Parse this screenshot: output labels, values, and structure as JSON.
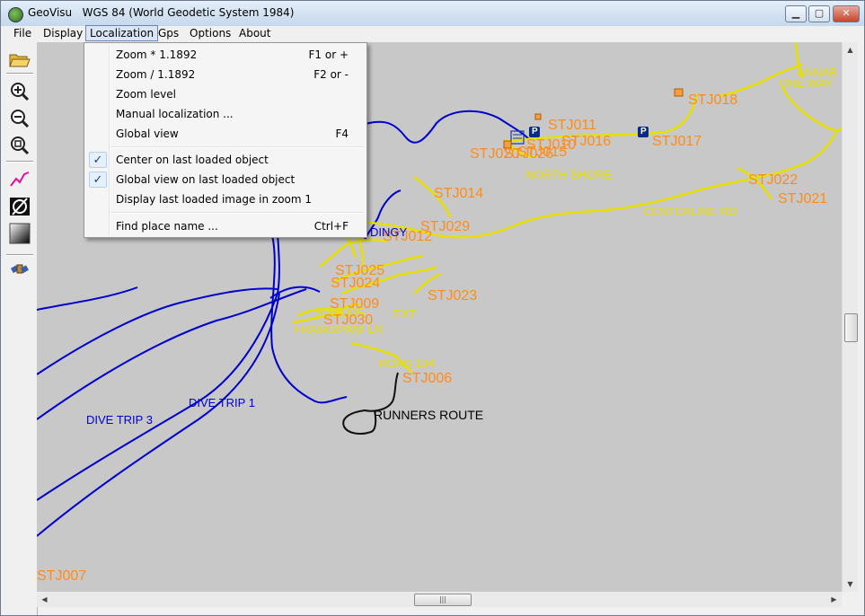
{
  "window": {
    "app_name": "GeoVisu",
    "projection": "WGS 84 (World Geodetic System 1984)",
    "min_label": "▁",
    "max_label": "▢",
    "close_label": "✕"
  },
  "menu": {
    "items": [
      "File",
      "Display",
      "Localization",
      "Gps",
      "Options",
      "About"
    ],
    "active": "Localization"
  },
  "dropdown": {
    "items": [
      {
        "label": "Zoom * 1.1892",
        "shortcut": "F1 or +",
        "checked": false
      },
      {
        "label": "Zoom / 1.1892",
        "shortcut": "F2 or -",
        "checked": false
      },
      {
        "label": "Zoom level",
        "shortcut": "",
        "checked": false
      },
      {
        "label": "Manual localization ...",
        "shortcut": "",
        "checked": false
      },
      {
        "label": "Global view",
        "shortcut": "F4",
        "checked": false
      },
      {
        "label": "Center on last loaded object",
        "shortcut": "",
        "checked": true
      },
      {
        "label": "Global view on last loaded object",
        "shortcut": "",
        "checked": true
      },
      {
        "label": "Display last loaded image in zoom 1",
        "shortcut": "",
        "checked": false
      },
      {
        "label": "Find place name ...",
        "shortcut": "Ctrl+F",
        "checked": false
      }
    ],
    "check_glyph": "✓"
  },
  "toolbar": {
    "buttons": [
      "open-folder-icon",
      "zoom-in-icon",
      "zoom-out-icon",
      "zoom-fit-icon",
      "track-icon",
      "vector-icon",
      "gradient-icon",
      "satellite-icon"
    ]
  },
  "map": {
    "background": "#c8c8c8",
    "colors": {
      "waypoint": "#ff8c1a",
      "road": "#ffe600",
      "dive": "#0000cc",
      "route": "#000000"
    },
    "waypoints": [
      "STJ011",
      "STJ016",
      "STJ010",
      "STJ015",
      "STJ020",
      "STJ026",
      "STJ018",
      "STJ017",
      "STJ022",
      "STJ021",
      "STJ014",
      "STJ029",
      "STJ012",
      "STJ025",
      "STJ024",
      "STJ009",
      "STJ005",
      "STJ030",
      "STJ023",
      "STJ006",
      "STJ007"
    ],
    "roads": [
      "ANNAB",
      "ONE WAY",
      "NORTH SHORE",
      "CENTERLINE RD",
      "FRANGIPANI LN",
      "ROAD 104",
      "EXT"
    ],
    "dive_labels": [
      "DIVE TRIP 1",
      "DIVE TRIP 3",
      "DINGY"
    ],
    "route_labels": [
      "RUNNERS ROUTE"
    ],
    "markers": {
      "parking": "P"
    }
  },
  "scrollbar": {
    "grip": "|||"
  }
}
